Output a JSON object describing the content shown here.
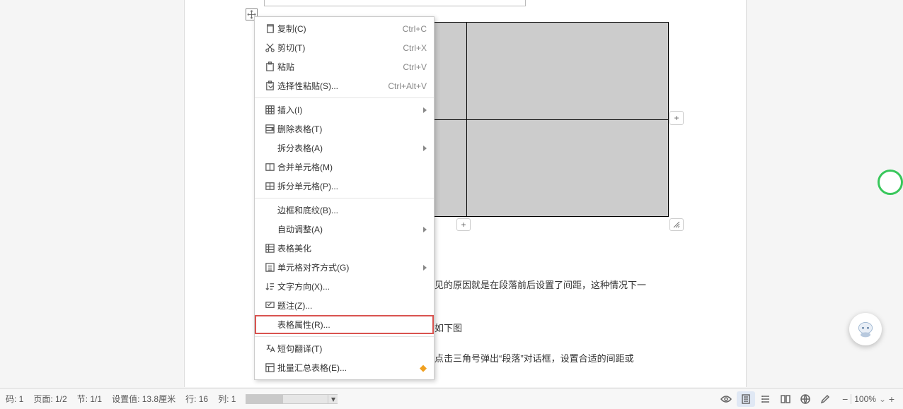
{
  "menu": {
    "copy": {
      "label": "复制(C)",
      "shortcut": "Ctrl+C"
    },
    "cut": {
      "label": "剪切(T)",
      "shortcut": "Ctrl+X"
    },
    "paste": {
      "label": "粘贴",
      "shortcut": "Ctrl+V"
    },
    "paste_special": {
      "label": "选择性粘贴(S)...",
      "shortcut": "Ctrl+Alt+V"
    },
    "insert": {
      "label": "插入(I)"
    },
    "delete_table": {
      "label": "删除表格(T)"
    },
    "split_table": {
      "label": "拆分表格(A)"
    },
    "merge_cells": {
      "label": "合并单元格(M)"
    },
    "split_cells": {
      "label": "拆分单元格(P)..."
    },
    "borders": {
      "label": "边框和底纹(B)..."
    },
    "autofit": {
      "label": "自动调整(A)"
    },
    "beautify": {
      "label": "表格美化"
    },
    "align": {
      "label": "单元格对齐方式(G)"
    },
    "text_dir": {
      "label": "文字方向(X)..."
    },
    "caption": {
      "label": "题注(Z)..."
    },
    "properties": {
      "label": "表格属性(R)..."
    },
    "translate": {
      "label": "短句翻译(T)"
    },
    "batch_summary": {
      "label": "批量汇总表格(E)..."
    }
  },
  "body": {
    "t1": "见的原因就是在段落前后设置了间距，这种情况下一",
    "t2": "如下图",
    "t3": "点击三角号弹出“段落”对话框，设置合适的间距或"
  },
  "status": {
    "page_no": "码: 1",
    "page": "页面: 1/2",
    "section": "节: 1/1",
    "setting": "设置值: 13.8厘米",
    "row": "行: 16",
    "col": "列: 1",
    "zoom": "100%"
  },
  "glyphs": {
    "plus": "+",
    "minus": "−",
    "caret": "⌄"
  }
}
